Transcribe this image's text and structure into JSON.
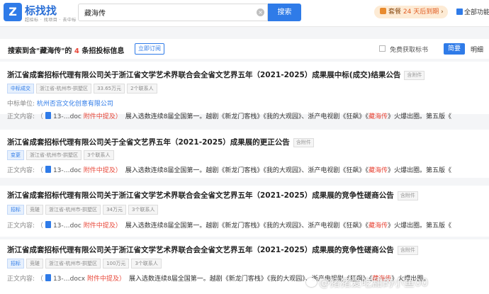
{
  "header": {
    "logo_glyph": "Z",
    "brand": "标找找",
    "brand_sub": "超招标 · 找项目 · 去中标",
    "search_value": "藏海传",
    "search_button": "搜索",
    "vip_label": "套餐",
    "vip_days": "24 天后到期",
    "vip_arrow": "›",
    "all_functions": "全部功能",
    "clear_icon": "×"
  },
  "results": {
    "prefix": "搜索到含",
    "keyword": "\"藏海传\"",
    "mid": "的",
    "count": "4",
    "suffix": "条招投标信息",
    "subscribe_label": "立即订阅",
    "free_label": "免费获取标书",
    "tab_brief": "简要",
    "tab_detail": "明细"
  },
  "items": [
    {
      "title": "浙江省成套招标代理有限公司关于浙江省文学艺术界联合会全省文艺界五年（2021-2025）成果展中标(成交)结果公告",
      "attach": "含附件",
      "tags": [
        "中标成交",
        "浙江省-杭州市-拱墅区",
        "33.65万元",
        "2个联系人"
      ],
      "winner_label": "中标单位:",
      "winner": "杭州否宫文化创意有限公司",
      "body_label": "正文内容:",
      "paren_open": "（",
      "file": "13-…doc",
      "attach_note": "附件中提及）",
      "text_pre": "展入选数连续8届全国第一。越剧《新龙门客栈》《我的大观园》、浙产电视剧《狂飙》《",
      "highlight": "藏海传",
      "text_post": "》火爆出圈。第五版《"
    },
    {
      "title": "浙江省成套招标代理有限公司关于全省文艺界五年（2021-2025）成果展的更正公告",
      "attach": "含附件",
      "tags": [
        "变更",
        "浙江省-杭州市-拱墅区",
        "3个联系人"
      ],
      "body_label": "正文内容:",
      "paren_open": "（",
      "file": "13-…doc",
      "attach_note": "附件中提及）",
      "text_pre": "展入选数连续8届全国第一。越剧《新龙门客栈》《我的大观园》、浙产电视剧《狂飙》《",
      "highlight": "藏海传",
      "text_post": "》火爆出圈。第五版《"
    },
    {
      "title": "浙江省成套招标代理有限公司关于浙江省文学艺术界联合会全省文艺界五年（2021-2025）成果展的竞争性磋商公告",
      "attach": "含附件",
      "tags": [
        "招标",
        "竞磋",
        "浙江省-杭州市-拱墅区",
        "34万元",
        "3个联系人"
      ],
      "body_label": "正文内容:",
      "paren_open": "（",
      "file": "13-…doc",
      "attach_note": "附件中提及）",
      "text_pre": "展入选数连续8届全国第一。越剧《新龙门客栈》《我的大观园》、浙产电视剧《狂飙》《",
      "highlight": "藏海传",
      "text_post": "》火爆出圈。第五版《"
    },
    {
      "title": "浙江省成套招标代理有限公司关于浙江省文学艺术界联合会全省文艺界五年（2021-2025）成果展的竞争性磋商公告",
      "attach": "含附件",
      "tags": [
        "招标",
        "竞磋",
        "浙江省-杭州市-拱墅区",
        "100万元",
        "3个联系人"
      ],
      "body_label": "正文内容:",
      "paren_open": "（",
      "file": "13-…docx",
      "attach_note": "附件中提及）",
      "text_pre": "展入选数连续8届全国第一。越剧《新龙门客栈》《我的大观园》、浙产电视剧《狂飙》《",
      "highlight": "藏海传",
      "text_post": "》火爆出圈。"
    }
  ],
  "watermark": "@猪猪爱吃甜的小鱼00",
  "colors": {
    "accent": "#2f7be8",
    "highlight": "#e8483a",
    "vip_bg": "#fdebd5"
  }
}
